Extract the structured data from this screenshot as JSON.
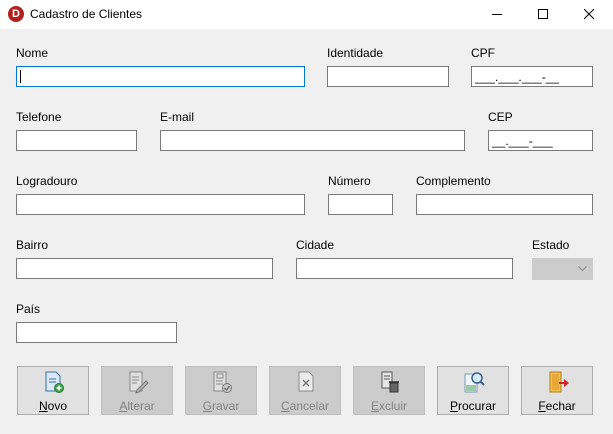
{
  "window": {
    "title": "Cadastro de Clientes",
    "app_icon_letter": "D"
  },
  "form": {
    "nome": {
      "label": "Nome",
      "value": ""
    },
    "identidade": {
      "label": "Identidade",
      "value": ""
    },
    "cpf": {
      "label": "CPF",
      "mask": "___.___.___-__"
    },
    "telefone": {
      "label": "Telefone",
      "value": ""
    },
    "email": {
      "label": "E-mail",
      "value": ""
    },
    "cep": {
      "label": "CEP",
      "mask": "__.___-___"
    },
    "logradouro": {
      "label": "Logradouro",
      "value": ""
    },
    "numero": {
      "label": "Número",
      "value": ""
    },
    "complemento": {
      "label": "Complemento",
      "value": ""
    },
    "bairro": {
      "label": "Bairro",
      "value": ""
    },
    "cidade": {
      "label": "Cidade",
      "value": ""
    },
    "estado": {
      "label": "Estado",
      "value": ""
    },
    "pais": {
      "label": "País",
      "value": ""
    }
  },
  "buttons": [
    {
      "first": "N",
      "rest": "ovo",
      "enabled": true,
      "icon": "new-document-icon"
    },
    {
      "first": "A",
      "rest": "lterar",
      "enabled": false,
      "icon": "edit-document-icon"
    },
    {
      "first": "G",
      "rest": "ravar",
      "enabled": false,
      "icon": "save-document-icon"
    },
    {
      "first": "C",
      "rest": "ancelar",
      "enabled": false,
      "icon": "cancel-document-icon"
    },
    {
      "first": "E",
      "rest": "xcluir",
      "enabled": false,
      "icon": "delete-icon"
    },
    {
      "first": "P",
      "rest": "rocurar",
      "enabled": true,
      "icon": "search-icon"
    },
    {
      "first": "F",
      "rest": "echar",
      "enabled": true,
      "icon": "exit-door-icon"
    }
  ],
  "colors": {
    "focus_border": "#0078d7",
    "app_icon": "#b3201e",
    "disabled_text": "#838383"
  }
}
